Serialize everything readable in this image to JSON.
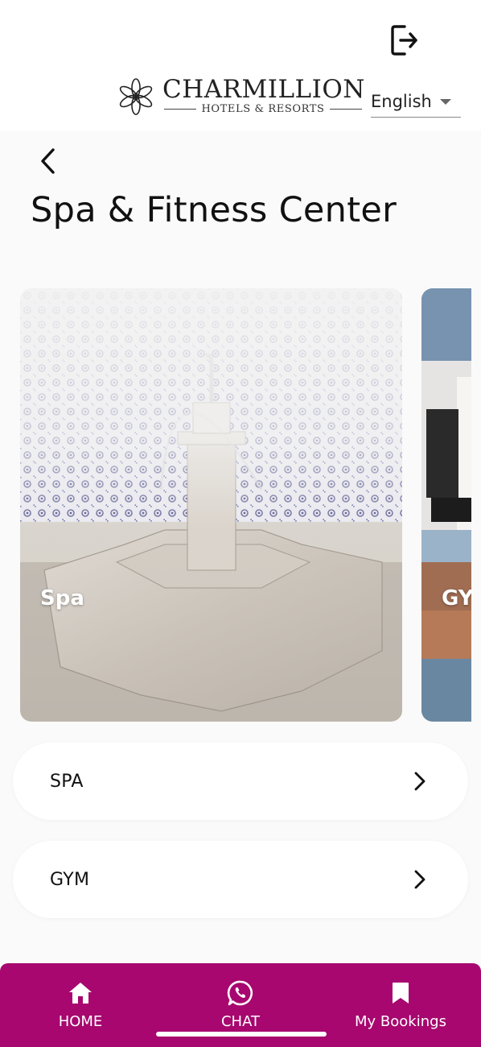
{
  "header": {
    "logout_icon": "logout-icon",
    "brand_name": "CHARMILLION",
    "brand_subtitle": "HOTELS & RESORTS",
    "language": "English"
  },
  "page": {
    "back_icon": "chevron-left-icon",
    "title": "Spa & Fitness Center"
  },
  "carousel": {
    "cards": [
      {
        "label": "Spa"
      },
      {
        "label": "GYM"
      }
    ]
  },
  "list": {
    "items": [
      {
        "label": "SPA",
        "icon": "chevron-right-icon"
      },
      {
        "label": "GYM",
        "icon": "chevron-right-icon"
      }
    ]
  },
  "bottom_nav": {
    "background": "#a7076f",
    "items": [
      {
        "label": "HOME",
        "icon": "home-icon"
      },
      {
        "label": "CHAT",
        "icon": "whatsapp-icon"
      },
      {
        "label": "My Bookings",
        "icon": "bookmark-icon"
      }
    ]
  }
}
